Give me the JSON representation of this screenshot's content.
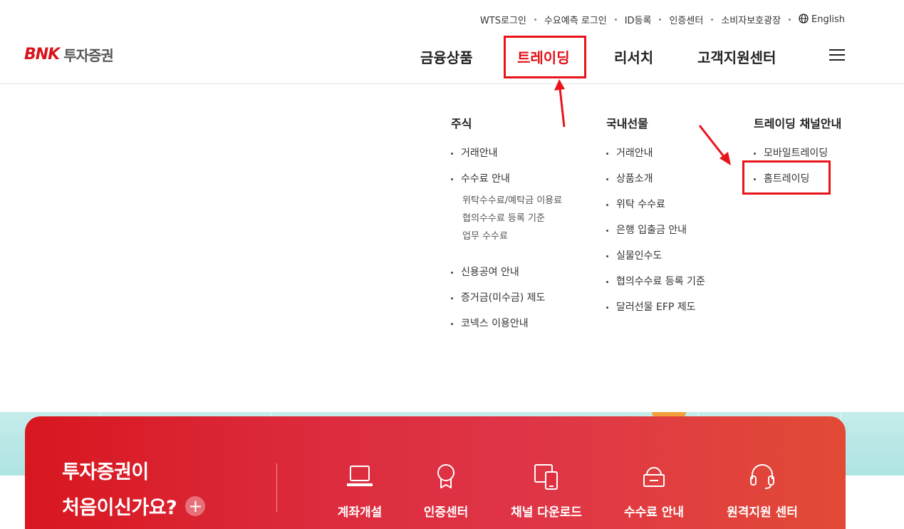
{
  "util_links": [
    "WTS로그인",
    "수요예측 로그인",
    "ID등록",
    "인증센터",
    "소비자보호광장"
  ],
  "lang_label": "English",
  "logo": {
    "mark": "BNK",
    "text": "투자증권"
  },
  "gnb": [
    "금융상품",
    "트레이딩",
    "리서치",
    "고객지원센터"
  ],
  "mega_menu": {
    "stock": {
      "title": "주식",
      "items_a": [
        "거래안내",
        "수수료 안내"
      ],
      "sub": [
        "위탁수수료/예탁금 이용료",
        "협의수수료 등록 기준",
        "업무 수수료"
      ],
      "items_b": [
        "신용공여 안내",
        "증거금(미수금) 제도",
        "코넥스 이용안내"
      ]
    },
    "futures": {
      "title": "국내선물",
      "items": [
        "거래안내",
        "상품소개",
        "위탁 수수료",
        "은행 입출금 안내",
        "실물인수도",
        "협의수수료 등록 기준",
        "달러선물 EFP 제도"
      ]
    },
    "channel": {
      "title": "트레이딩 채널안내",
      "items": [
        "모바일트레이딩",
        "홈트레이딩"
      ]
    }
  },
  "banner": {
    "line1": "투자증권이",
    "line2": "처음이신가요?",
    "plus": "+",
    "quick": [
      "계좌개설",
      "인증센터",
      "채널 다운로드",
      "수수료 안내",
      "원격지원 센터"
    ]
  },
  "colors": {
    "accent": "#e0121a",
    "annotation": "#e8141a"
  },
  "icons": [
    "globe-icon",
    "hamburger-icon",
    "laptop-icon",
    "certificate-icon",
    "devices-icon",
    "fee-icon",
    "headset-icon"
  ]
}
